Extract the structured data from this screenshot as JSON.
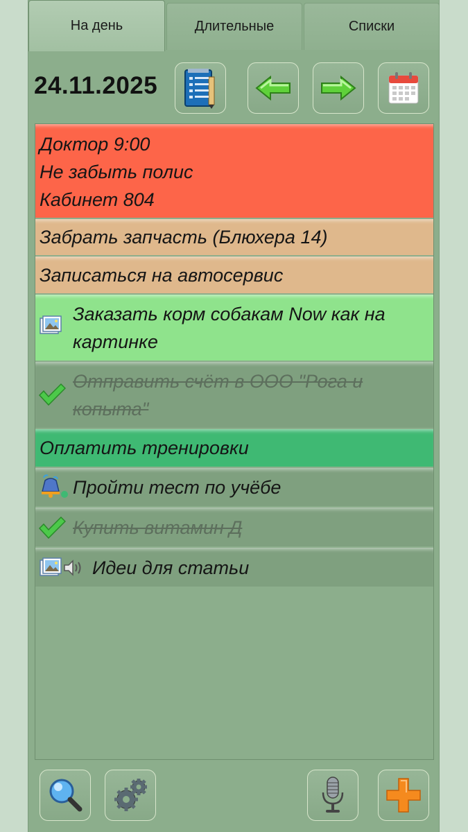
{
  "tabs": [
    {
      "label": "На день"
    },
    {
      "label": "Длительные"
    },
    {
      "label": "Списки"
    }
  ],
  "header": {
    "date": "24.11.2025",
    "buttons": [
      "notepad-icon",
      "arrow-left-icon",
      "arrow-right-icon",
      "calendar-icon"
    ]
  },
  "tasks": [
    {
      "lines": [
        "Доктор 9:00",
        "Не забыть полис",
        "Кабинет 804"
      ],
      "color": "#fd6549"
    },
    {
      "lines": [
        "Забрать запчасть (Блюхера 14)"
      ],
      "color": "#dfb88c"
    },
    {
      "lines": [
        "Записаться на автосервис"
      ],
      "color": "#dfb88c"
    },
    {
      "lines": [
        "Заказать корм собакам Now как на",
        "картинке"
      ],
      "color": "#8fe38c",
      "icons": [
        "image-icon"
      ]
    },
    {
      "lines": [
        "Отправить счёт в ООО \"Рога и",
        "копыта\""
      ],
      "color": "#7fa07f",
      "done": true,
      "icons": [
        "checkmark-icon"
      ]
    },
    {
      "lines": [
        "Оплатить тренировки"
      ],
      "color": "#3fb973"
    },
    {
      "lines": [
        "Пройти тест по учёбе"
      ],
      "color": "#7fa07f",
      "icons": [
        "bell-icon"
      ]
    },
    {
      "lines": [
        "Купить витамин Д"
      ],
      "color": "#7fa07f",
      "done": true,
      "icons": [
        "checkmark-icon"
      ]
    },
    {
      "lines": [
        "Идеи для статьи"
      ],
      "color": "#7fa07f",
      "icons": [
        "image-icon",
        "speaker-icon"
      ]
    }
  ],
  "toolbar": [
    "search-icon",
    "settings-gears-icon",
    "microphone-icon",
    "plus-icon"
  ]
}
